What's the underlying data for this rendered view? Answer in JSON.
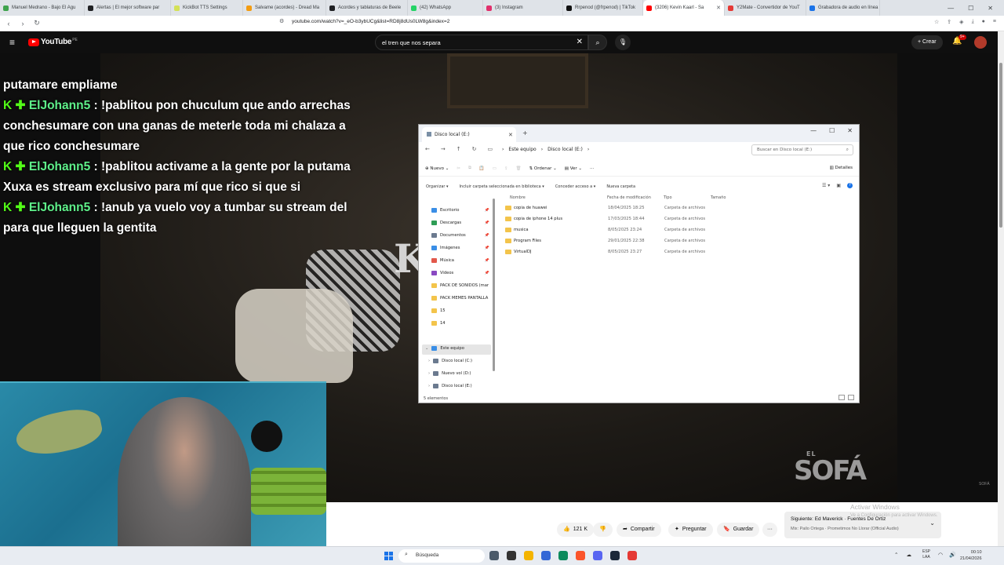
{
  "browser": {
    "tabs": [
      {
        "label": "Manuel Medrano - Bajo El Agu",
        "color": "#3fa34d"
      },
      {
        "label": "Alertas | El mejor software par",
        "color": "#202124"
      },
      {
        "label": "KickBot TTS Settings",
        "color": "#d4e157"
      },
      {
        "label": "Salvame (acordes) - Dread Ma",
        "color": "#f39c12"
      },
      {
        "label": "Acordes y tablaturas de Beele",
        "color": "#202124"
      },
      {
        "label": "(42) WhatsApp",
        "color": "#25d366"
      },
      {
        "label": "(3) Instagram",
        "color": "#e1306c"
      },
      {
        "label": "Rrpenod (@frpenod) | TikTok",
        "color": "#111111"
      },
      {
        "label": "(3206) Kevin Kaarl - Sa",
        "color": "#ff0000"
      },
      {
        "label": "Y2Mate - Convertidor de YouT",
        "color": "#e53935"
      },
      {
        "label": "Grabadora de audio en línea",
        "color": "#1a73e8"
      }
    ],
    "url": "youtube.com/watch?v=_eO-b3ybUCg&list=RD8j8dUs0LW8g&index=2"
  },
  "youtube": {
    "logo": "YouTube",
    "country_code": "PE",
    "search_value": "el tren que nos separa",
    "create_label": "Crear",
    "notif_count": "9+"
  },
  "chat": {
    "lines": [
      {
        "user": "",
        "text": "putamare empliame"
      },
      {
        "user": "ElJohann5",
        "text": " : !pablitou pon chuculum que ando arrechas"
      },
      {
        "user": "",
        "text": "conchesumare con una ganas de meterle toda mi chalaza a"
      },
      {
        "user": "",
        "text": "que rico conchesumare"
      },
      {
        "user": "ElJohann5",
        "text": " : !pablitou activame a la gente por la putama"
      },
      {
        "user": "",
        "text": "Xuxa es stream exclusivo para mí que rico si que si"
      },
      {
        "user": "ElJohann5",
        "text": " : !anub ya vuelo voy a tumbar su stream del"
      },
      {
        "user": "",
        "text": "para que lleguen la gentita"
      }
    ],
    "kick_icon": "K ✚"
  },
  "video": {
    "overlay_letters": "K",
    "brand_small": "EL",
    "brand": "SOFÁ",
    "watermark": "SOFÁ"
  },
  "explorer": {
    "tab_title": "Disco local (E:)",
    "breadcrumb": [
      "Este equipo",
      "Disco local (E:)"
    ],
    "search_placeholder": "Buscar en Disco local (E:)",
    "toolbar": {
      "new": "Nuevo",
      "sort": "Ordenar",
      "view": "Ver",
      "details": "Detalles"
    },
    "cmdbar": [
      "Organizar",
      "Incluir carpeta seleccionada en biblioteca",
      "Conceder acceso a",
      "Nueva carpeta"
    ],
    "sidebar": [
      {
        "label": "Escritorio",
        "color": "#3a8ee6"
      },
      {
        "label": "Descargas",
        "color": "#2e9d55"
      },
      {
        "label": "Documentos",
        "color": "#6b7a8f"
      },
      {
        "label": "Imágenes",
        "color": "#3a8ee6"
      },
      {
        "label": "Música",
        "color": "#e2584b"
      },
      {
        "label": "Videos",
        "color": "#8a49c2"
      },
      {
        "label": "PACK DE SONIDOS (mar",
        "color": "#f3c44b"
      },
      {
        "label": "PACK MEMES PANTALLA",
        "color": "#f3c44b"
      },
      {
        "label": "15",
        "color": "#f3c44b"
      },
      {
        "label": "14",
        "color": "#f3c44b"
      },
      {
        "label": "Este equipo",
        "color": "#3a8ee6"
      },
      {
        "label": "Disco local (C:)",
        "color": "#6b7a8f"
      },
      {
        "label": "Nuevo vol (D:)",
        "color": "#6b7a8f"
      },
      {
        "label": "Disco local (E:)",
        "color": "#6b7a8f"
      }
    ],
    "columns": {
      "name": "Nombre",
      "date": "Fecha de modificación",
      "type": "Tipo",
      "size": "Tamaño"
    },
    "files": [
      {
        "name": "copia de huawei",
        "date": "18/04/2025 18:25",
        "type": "Carpeta de archivos"
      },
      {
        "name": "copia de iphone 14 plus",
        "date": "17/03/2025 18:44",
        "type": "Carpeta de archivos"
      },
      {
        "name": "musica",
        "date": "8/05/2025 23:24",
        "type": "Carpeta de archivos"
      },
      {
        "name": "Program Files",
        "date": "29/01/2025 22:38",
        "type": "Carpeta de archivos"
      },
      {
        "name": "VirtualDJ",
        "date": "8/05/2025 23:27",
        "type": "Carpeta de archivos"
      }
    ],
    "status": "5 elementos"
  },
  "below": {
    "likes": "121 K",
    "share": "Compartir",
    "ask": "Preguntar",
    "save": "Guardar",
    "next_title": "Siguiente: Ed Maverick · Fuentes De Ortiz",
    "next_sub": "Mix: Pailo Ortega · Prometimos No Llorar (Official Audio)",
    "activate_title": "Activar Windows",
    "activate_sub": "Ve a Configuración para activar Windows."
  },
  "taskbar": {
    "search": "Búsqueda",
    "lang1": "ESP",
    "lang2": "LAA",
    "time": "00:10",
    "date": "21/04/2026",
    "app_colors": [
      "#4a5a6a",
      "#333333",
      "#f4b400",
      "#3367d6",
      "#0b8a5c",
      "#fb542b",
      "#5865f2",
      "#1b2838",
      "#e53935"
    ]
  }
}
